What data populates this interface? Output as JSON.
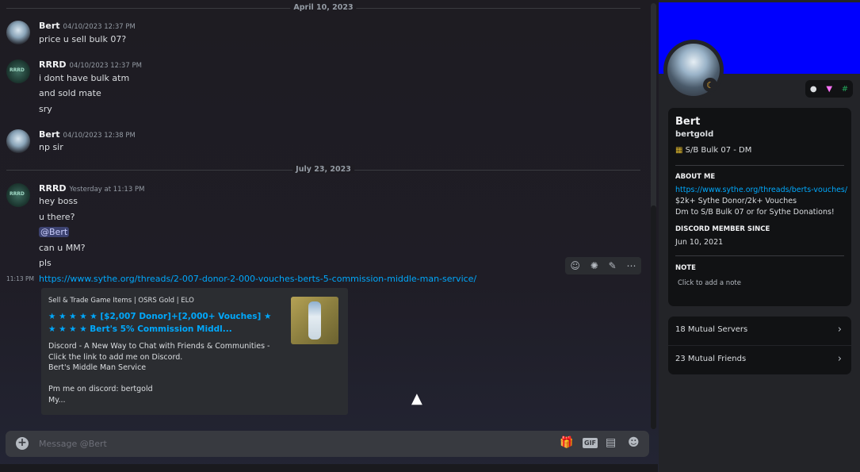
{
  "chat": {
    "dividers": [
      "April 10, 2023",
      "July 23, 2023"
    ],
    "messages": [
      {
        "author": "Bert",
        "time": "04/10/2023 12:37 PM",
        "lines": [
          "price u sell bulk 07?"
        ]
      },
      {
        "author": "RRRD",
        "time": "04/10/2023 12:37 PM",
        "lines": [
          "i dont have bulk atm",
          "and sold mate",
          "sry"
        ]
      },
      {
        "author": "Bert",
        "time": "04/10/2023 12:38 PM",
        "lines": [
          "np sir"
        ]
      },
      {
        "author": "RRRD",
        "time": "Yesterday at 11:13 PM",
        "lines": [
          "hey boss",
          "u there?",
          "@Bert",
          "can u MM?",
          "pls"
        ]
      }
    ],
    "link_message": {
      "gutter_time": "11:13 PM",
      "url": "https://www.sythe.org/threads/2-007-donor-2-000-vouches-berts-5-commission-middle-man-service/"
    },
    "embed": {
      "provider": "Sell & Trade Game Items | OSRS Gold | ELO",
      "title": "★ ★ ★ ★ ★ [$2,007 Donor]+[2,000+ Vouches] ★ ★ ★ ★ ★ Bert's 5% Commission Middl...",
      "description": "Discord - A New Way to Chat with Friends & Communities - Click the link to add me on Discord.\nBert's Middle Man Service\n\nPm me on discord: bertgold\nMy..."
    },
    "toolbar_icons": [
      "add-reaction-icon",
      "super-reaction-icon",
      "edit-icon",
      "more-icon"
    ],
    "composer": {
      "placeholder": "Message @Bert",
      "gif_label": "GIF"
    }
  },
  "profile": {
    "display_name": "Bert",
    "username": "bertgold",
    "custom_status": "S/B Bulk 07 - DM",
    "about_me_header": "ABOUT ME",
    "about_me_link": "https://www.sythe.org/threads/berts-vouches/",
    "about_me_lines": [
      "$2k+ Sythe Donor/2k+ Vouches",
      "Dm to S/B Bulk 07 or for Sythe Donations!"
    ],
    "member_since_header": "DISCORD MEMBER SINCE",
    "member_since": "Jun 10, 2021",
    "note_header": "NOTE",
    "note_placeholder": "Click to add a note",
    "mutual_servers": "18 Mutual Servers",
    "mutual_friends": "23 Mutual Friends",
    "banner_color": "#0000fe"
  }
}
